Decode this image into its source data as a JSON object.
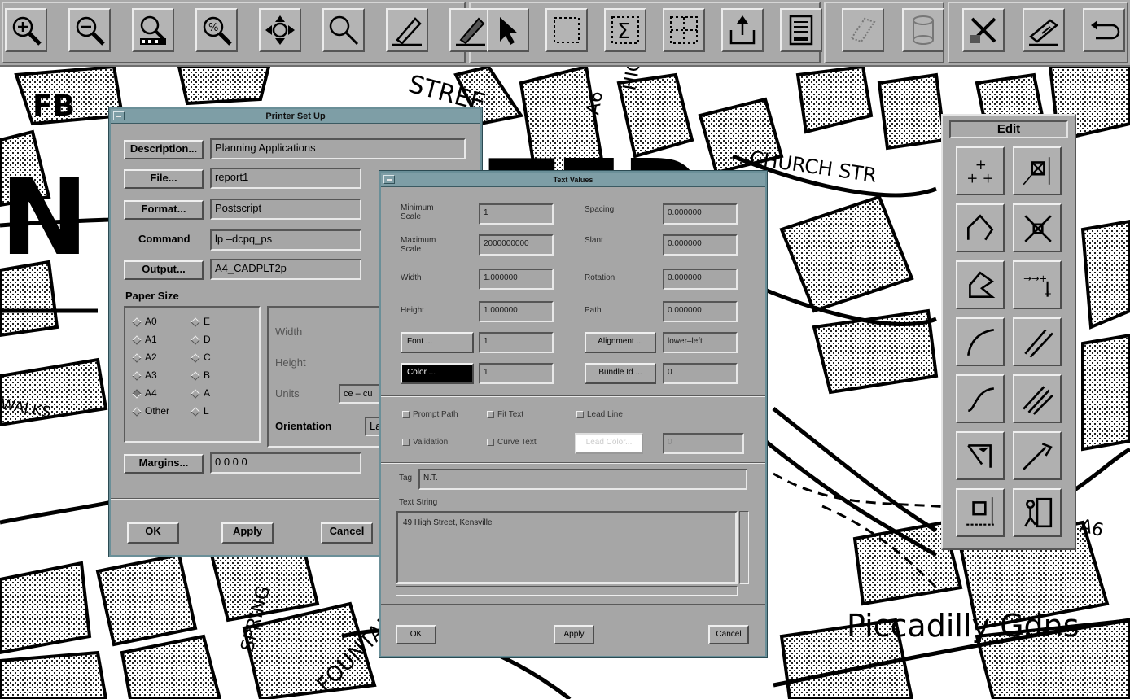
{
  "map": {
    "labels": {
      "street_top": "STREE",
      "church_street": "CHURCH STR",
      "fb": "FB",
      "spring": "SPRING",
      "fountain": "FOUNTAI",
      "piccadilly": "Piccadilly Gdns",
      "a6_top": "A6",
      "a6_right": "A6",
      "walks": "WALKS",
      "high": "HIGH"
    }
  },
  "toolbar": {
    "buttons": [
      {
        "icon": "zoom-in-icon"
      },
      {
        "icon": "zoom-out-icon"
      },
      {
        "icon": "zoom-window-icon"
      },
      {
        "icon": "zoom-percent-icon"
      },
      {
        "icon": "pan-icon"
      },
      {
        "icon": "zoom-icon"
      },
      {
        "icon": "draw-pencil-icon"
      },
      {
        "icon": "hatch-pencil-icon"
      },
      {
        "icon": "select-arrow-icon"
      },
      {
        "icon": "select-box-icon"
      },
      {
        "icon": "sum-select-icon"
      },
      {
        "icon": "grid-select-icon"
      },
      {
        "icon": "export-icon"
      },
      {
        "icon": "document-icon"
      },
      {
        "icon": "layer-dotted-icon"
      },
      {
        "icon": "cylinder-icon"
      },
      {
        "icon": "tools-icon"
      },
      {
        "icon": "plotter-icon"
      },
      {
        "icon": "undo-icon"
      }
    ]
  },
  "printer_setup": {
    "title": "Printer Set Up",
    "description_button": "Description...",
    "description_value": "Planning Applications",
    "file_button": "File...",
    "file_value": "report1",
    "format_button": "Format...",
    "format_value": "Postscript",
    "command_label": "Command",
    "command_value": "lp –dcpq_ps",
    "output_button": "Output...",
    "output_value": "A4_CADPLT2p",
    "paper_size_label": "Paper Size",
    "paper_sizes_col1": [
      "A0",
      "A1",
      "A2",
      "A3",
      "A4",
      "Other"
    ],
    "paper_sizes_col2": [
      "E",
      "D",
      "C",
      "B",
      "A",
      "L"
    ],
    "selected_paper": "A4",
    "width_label": "Width",
    "height_label": "Height",
    "units_label": "Units",
    "units_value": "ce – cu",
    "orientation_label": "Orientation",
    "orientation_value": "La",
    "margins_button": "Margins...",
    "margins_value": "0 0 0 0",
    "ok_button": "OK",
    "apply_button": "Apply",
    "cancel_button": "Cancel"
  },
  "text_values": {
    "title": "Text Values",
    "minimum_scale_label": "Minimum\nScale",
    "minimum_scale_value": "1",
    "maximum_scale_label": "Maximum\nScale",
    "maximum_scale_value": "2000000000",
    "width_label": "Width",
    "width_value": "1.000000",
    "height_label": "Height",
    "height_value": "1.000000",
    "font_button": "Font ...",
    "font_value": "1",
    "color_button": "Color ...",
    "color_value": "1",
    "spacing_label": "Spacing",
    "spacing_value": "0.000000",
    "slant_label": "Slant",
    "slant_value": "0.000000",
    "rotation_label": "Rotation",
    "rotation_value": "0.000000",
    "path_label": "Path",
    "path_value": "0.000000",
    "alignment_button": "Alignment ...",
    "alignment_value": "lower–left",
    "bundle_button": "Bundle Id ...",
    "bundle_value": "0",
    "prompt_path": "Prompt Path",
    "fit_text": "Fit Text",
    "lead_line": "Lead Line",
    "validation": "Validation",
    "curve_text": "Curve Text",
    "lead_color_button": "Lead Color...",
    "lead_color_value": "0",
    "tag_label": "Tag",
    "tag_value": "N.T.",
    "text_string_label": "Text String",
    "text_string_value": "49 High Street, Kensville",
    "ok_button": "OK",
    "apply_button": "Apply",
    "cancel_button": "Cancel"
  },
  "edit_palette": {
    "title": "Edit",
    "tools": [
      {
        "icon": "add-points-icon"
      },
      {
        "icon": "move-box-icon"
      },
      {
        "icon": "polyline-icon"
      },
      {
        "icon": "delete-point-icon"
      },
      {
        "icon": "polygon-icon"
      },
      {
        "icon": "move-vertex-icon"
      },
      {
        "icon": "arc-icon"
      },
      {
        "icon": "parallel-line-icon"
      },
      {
        "icon": "curve-icon"
      },
      {
        "icon": "multi-parallel-icon"
      },
      {
        "icon": "angle-line-icon"
      },
      {
        "icon": "extend-line-icon"
      },
      {
        "icon": "place-symbol-icon"
      },
      {
        "icon": "exit-icon"
      }
    ]
  }
}
